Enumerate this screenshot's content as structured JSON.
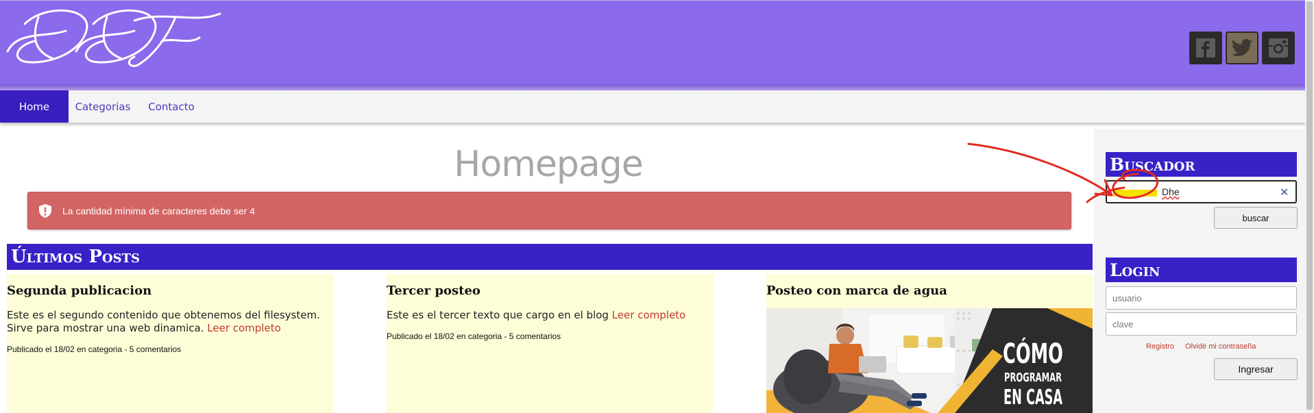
{
  "header": {
    "logo_text": "DDT",
    "social": [
      {
        "name": "facebook-icon",
        "color": "#2b2929"
      },
      {
        "name": "twitter-icon",
        "color": "#7a6d58"
      },
      {
        "name": "instagram-icon",
        "color": "#2b2929"
      }
    ]
  },
  "nav": {
    "items": [
      {
        "label": "Home"
      },
      {
        "label": "Categorias"
      },
      {
        "label": "Contacto"
      }
    ]
  },
  "main": {
    "page_title": "Homepage",
    "alert_text": "La cantidad mínima de caracteres debe ser 4",
    "section_title": "Últimos Posts",
    "posts": [
      {
        "title": "Segunda publicacion",
        "body": "Este es el segundo contenido que obtenemos del filesystem. Sirve para mostrar una web dinamica.",
        "link": "Leer completo",
        "meta": "Publicado el 18/02 en categoria - 5 comentarios"
      },
      {
        "title": "Tercer posteo",
        "body": "Este es el tercer texto que cargo en el blog",
        "link": "Leer completo",
        "meta": "Publicado el 18/02 en categoria - 5 comentarios"
      },
      {
        "title": "Posteo con marca de agua",
        "image_text": [
          "CÓMO",
          "PROGRAMAR",
          "EN CASA"
        ]
      }
    ]
  },
  "sidebar": {
    "search_title": "Buscador",
    "search_value": "Dhe",
    "search_button": "buscar",
    "login_title": "Login",
    "user_placeholder": "usuario",
    "password_placeholder": "clave",
    "register_link": "Registro",
    "forgot_link": "Olvidé mi contraseña",
    "login_button": "Ingresar"
  },
  "colors": {
    "header": "#8b6aeb",
    "nav_active": "#3a1dbf",
    "section": "#3721c7",
    "alert": "#d26463",
    "post_bg": "#fdfdd8",
    "link": "#c0392b"
  }
}
